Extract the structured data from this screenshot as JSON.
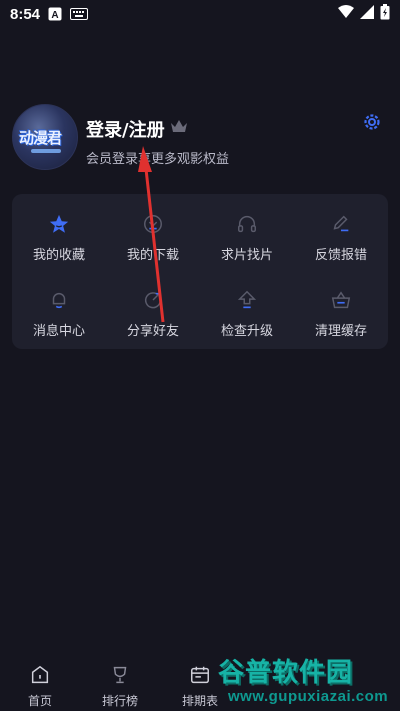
{
  "status_bar": {
    "time": "8:54"
  },
  "profile": {
    "avatar_text": "动漫君",
    "title": "登录/注册",
    "subtitle": "会员登录享更多观影权益"
  },
  "grid": {
    "items": [
      {
        "label": "我的收藏",
        "icon": "star-icon"
      },
      {
        "label": "我的下载",
        "icon": "download-icon"
      },
      {
        "label": "求片找片",
        "icon": "headphones-icon"
      },
      {
        "label": "反馈报错",
        "icon": "edit-icon"
      },
      {
        "label": "消息中心",
        "icon": "bell-icon"
      },
      {
        "label": "分享好友",
        "icon": "share-icon"
      },
      {
        "label": "检查升级",
        "icon": "upgrade-arrow-icon"
      },
      {
        "label": "清理缓存",
        "icon": "basket-icon"
      }
    ]
  },
  "bottom_nav": {
    "items": [
      {
        "label": "首页",
        "icon": "home-icon"
      },
      {
        "label": "排行榜",
        "icon": "trophy-icon"
      },
      {
        "label": "排期表",
        "icon": "calendar-icon"
      }
    ]
  },
  "watermark": {
    "name": "谷普软件园",
    "url": "www.gupuxiazai.com"
  },
  "colors": {
    "background": "#15151f",
    "card": "#1f202d",
    "accent": "#3f6df5",
    "arrow": "#e0312f"
  }
}
